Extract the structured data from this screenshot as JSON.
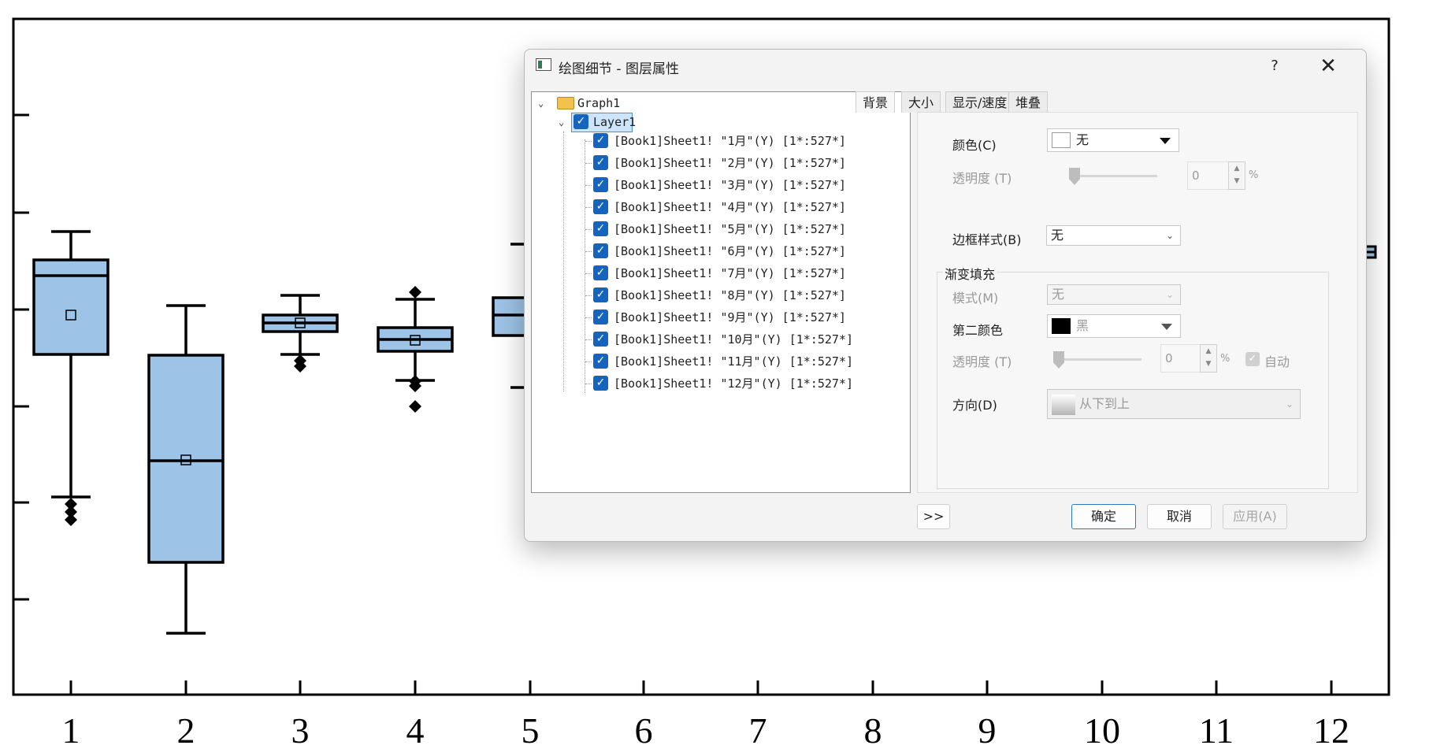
{
  "chart_data": {
    "type": "box",
    "categories": [
      "1",
      "2",
      "3",
      "4",
      "5",
      "6",
      "7",
      "8",
      "9",
      "10",
      "11",
      "12"
    ],
    "y_axis": {
      "ticks_labeled": false
    }
  },
  "dialog": {
    "title": "绘图细节 - 图层属性",
    "help": "?",
    "close": "✕",
    "tree": {
      "root": "Graph1",
      "layer": "Layer1",
      "items": [
        "[Book1]Sheet1! \"1月\"(Y) [1*:527*]",
        "[Book1]Sheet1! \"2月\"(Y) [1*:527*]",
        "[Book1]Sheet1! \"3月\"(Y) [1*:527*]",
        "[Book1]Sheet1! \"4月\"(Y) [1*:527*]",
        "[Book1]Sheet1! \"5月\"(Y) [1*:527*]",
        "[Book1]Sheet1! \"6月\"(Y) [1*:527*]",
        "[Book1]Sheet1! \"7月\"(Y) [1*:527*]",
        "[Book1]Sheet1! \"8月\"(Y) [1*:527*]",
        "[Book1]Sheet1! \"9月\"(Y) [1*:527*]",
        "[Book1]Sheet1! \"10月\"(Y) [1*:527*]",
        "[Book1]Sheet1! \"11月\"(Y) [1*:527*]",
        "[Book1]Sheet1! \"12月\"(Y) [1*:527*]"
      ]
    },
    "tabs": [
      "背景",
      "大小",
      "显示/速度",
      "堆叠"
    ],
    "background": {
      "color_label": "颜色(C)",
      "color_value": "无",
      "transparency_label": "透明度 (T)",
      "transparency_value": "0",
      "percent": "%",
      "border_style_label": "边框样式(B)",
      "border_style_value": "无",
      "gradient_group": "渐变填充",
      "mode_label": "模式(M)",
      "mode_value": "无",
      "second_color_label": "第二颜色",
      "second_color_value": "黑",
      "transparency2_label": "透明度 (T)",
      "transparency2_value": "0",
      "auto_label": "自动",
      "direction_label": "方向(D)",
      "direction_value": "从下到上"
    },
    "buttons": {
      "expand": ">>",
      "ok": "确定",
      "cancel": "取消",
      "apply": "应用(A)"
    }
  },
  "colors": {
    "box_fill": "#9dc3e6",
    "accent": "#1565c0"
  }
}
